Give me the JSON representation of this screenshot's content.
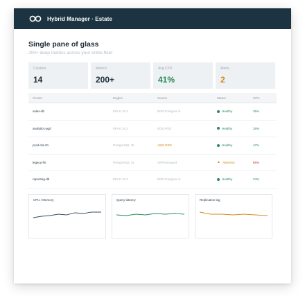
{
  "app": {
    "title": "Hybrid Manager · Estate"
  },
  "page": {
    "heading": "Single pane of glass",
    "subheading": "200+ deep metrics across your entire fleet"
  },
  "stats": [
    {
      "label": "Clusters",
      "value": "14",
      "color": "#1d2b36"
    },
    {
      "label": "Metrics",
      "value": "200+",
      "color": "#1d2b36"
    },
    {
      "label": "Avg CPU",
      "value": "41%",
      "color": "#2a8a5a"
    },
    {
      "label": "Alerts",
      "value": "2",
      "color": "#d08a1e"
    }
  ],
  "table": {
    "headers": {
      "cluster": "Cluster",
      "engine": "Engine",
      "source": "Source",
      "status": "Status",
      "cpu": "CPU"
    },
    "rows": [
      {
        "cluster": "sales-db",
        "engine": "EPAS 16.2",
        "source": "EDB Postgres AI",
        "status": "Healthy",
        "cpu": "35%",
        "state": "ok"
      },
      {
        "cluster": "analytics-pgd",
        "engine": "EPAS 16.2",
        "source": "EDB PGD",
        "status": "Healthy",
        "cpu": "28%",
        "state": "ok"
      },
      {
        "cluster": "prod-rds-01",
        "engine": "PostgreSQL 15",
        "source": "AWS RDS",
        "status": "Healthy",
        "cpu": "47%",
        "state": "ok"
      },
      {
        "cluster": "legacy-fin",
        "engine": "PostgreSQL 14",
        "source": "Self-Managed",
        "status": "Attention",
        "cpu": "88%",
        "state": "warn"
      },
      {
        "cluster": "reporting-db",
        "engine": "EPAS 16.2",
        "source": "EDB Postgres AI",
        "status": "Healthy",
        "cpu": "24%",
        "state": "ok"
      }
    ]
  },
  "charts": [
    {
      "label": "CPU / Memory",
      "color": "#34495e"
    },
    {
      "label": "Query latency",
      "color": "#2a8a5a"
    },
    {
      "label": "Replication lag",
      "color": "#d08a1e"
    }
  ],
  "colors": {
    "titlebar": "#1c3342",
    "ok": "#2a8a5a",
    "warn": "#d08a1e",
    "bad": "#c0392b"
  }
}
